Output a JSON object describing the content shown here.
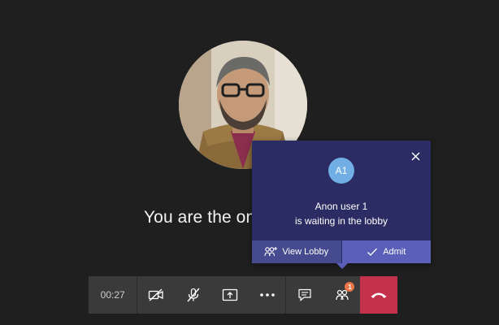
{
  "call": {
    "status_text": "You are the on",
    "timer": "00:27",
    "participants_badge": "1"
  },
  "lobby_popup": {
    "user_initials": "A1",
    "user_name": "Anon user 1",
    "message": "is waiting in the lobby",
    "view_lobby_label": "View Lobby",
    "admit_label": "Admit"
  },
  "colors": {
    "popup_bg": "#2b2c63",
    "view_lobby_bg": "#464a8f",
    "admit_bg": "#5b5fb8",
    "user_badge": "#71aee3",
    "hangup": "#c4314b",
    "notification_badge": "#e97548",
    "control_bar": "#3a3a3a"
  },
  "icons": {
    "close": "close-icon",
    "view_lobby": "people-add-icon",
    "admit": "checkmark-icon",
    "camera": "camera-off-icon",
    "mic": "mic-off-icon",
    "share": "share-screen-icon",
    "more": "more-icon",
    "chat": "chat-icon",
    "participants": "participants-icon",
    "hangup": "hang-up-icon"
  }
}
